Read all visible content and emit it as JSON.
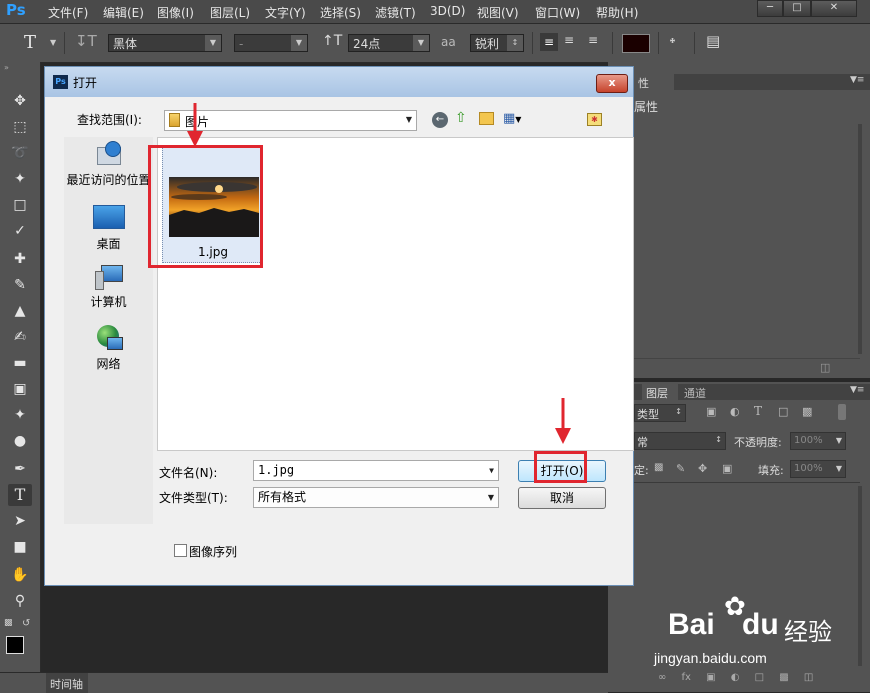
{
  "app": {
    "logo": "Ps"
  },
  "menu": [
    "文件(F)",
    "编辑(E)",
    "图像(I)",
    "图层(L)",
    "文字(Y)",
    "选择(S)",
    "滤镜(T)",
    "3D(D)",
    "视图(V)",
    "窗口(W)",
    "帮助(H)"
  ],
  "options": {
    "font_family": "黑体",
    "font_style": "-",
    "font_size": "24点",
    "aa_label": "a",
    "aa_mode": "锐利"
  },
  "dialog": {
    "title": "打开",
    "ps_icon": "Ps",
    "close": "x",
    "look_in_label": "查找范围(I):",
    "look_in_value": "图片",
    "places": [
      "最近访问的位置",
      "桌面",
      "计算机",
      "网络"
    ],
    "file": {
      "name": "1.jpg"
    },
    "filename_label": "文件名(N):",
    "filename_value": "1.jpg",
    "filetype_label": "文件类型(T):",
    "filetype_value": "所有格式",
    "open_button": "打开(O)",
    "cancel_button": "取消",
    "image_sequence_label": "图像序列"
  },
  "panels": {
    "properties_tab": "性",
    "properties_title": "属性",
    "layers_tab": "图层",
    "channels_tab": "通道",
    "kind_label": "类型",
    "blend_mode": "常",
    "opacity_label": "不透明度:",
    "opacity_value": "100%",
    "lock_label": "定:",
    "fill_label": "填充:",
    "fill_value": "100%"
  },
  "statusbar": {
    "timeline_tab": "时间轴"
  },
  "watermark": {
    "brand_a": "Bai",
    "brand_b": "du",
    "brand_c": "经验",
    "url": "jingyan.baidu.com"
  },
  "colors": {
    "highlight_red": "#e0262f",
    "ps_blue": "#2fa0ff"
  }
}
